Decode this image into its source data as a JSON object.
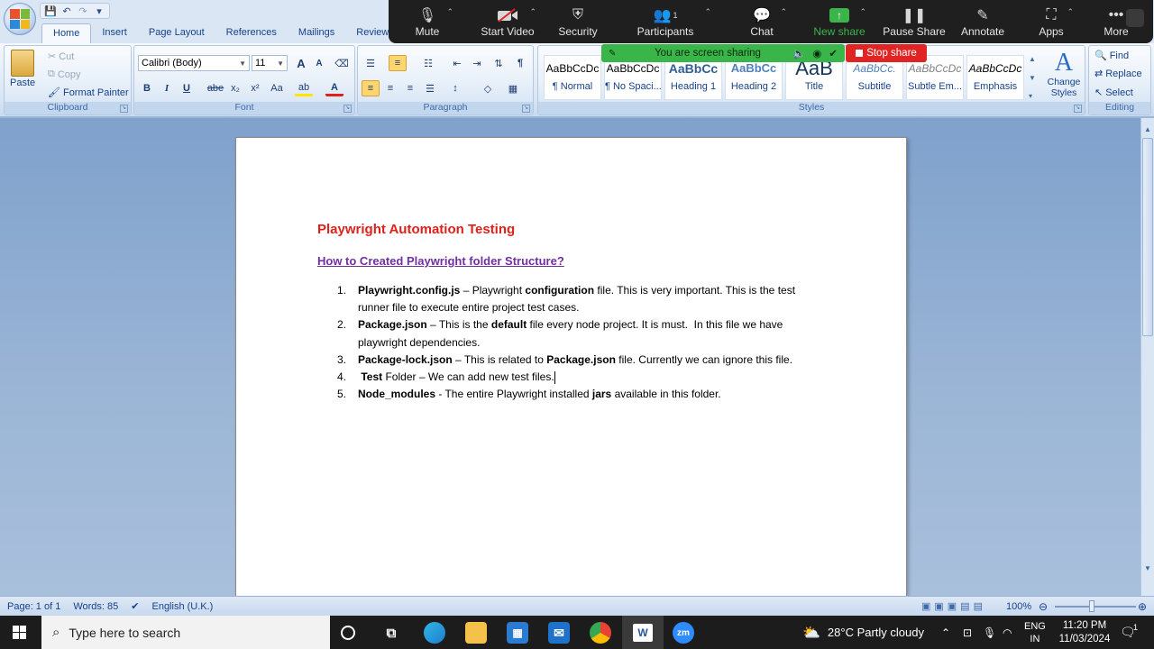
{
  "quick_access": {
    "save_icon": "save-icon",
    "undo_icon": "undo-icon",
    "redo_icon": "redo-icon",
    "more": "▾"
  },
  "tabs": [
    "Home",
    "Insert",
    "Page Layout",
    "References",
    "Mailings",
    "Review"
  ],
  "ribbon": {
    "clipboard": {
      "label": "Clipboard",
      "paste": "Paste",
      "cut": "Cut",
      "copy": "Copy",
      "format_painter": "Format Painter"
    },
    "font": {
      "label": "Font",
      "family": "Calibri (Body)",
      "size": "11",
      "grow": "A",
      "shrink": "A",
      "bold": "B",
      "italic": "I",
      "underline": "U",
      "strike": "abe",
      "sub": "x₂",
      "sup": "x²",
      "case": "Aa",
      "color": "A"
    },
    "paragraph": {
      "label": "Paragraph",
      "show_marks": "¶"
    },
    "styles": {
      "label": "Styles",
      "items": [
        {
          "preview": "AaBbCcDc",
          "name": "¶ Normal"
        },
        {
          "preview": "AaBbCcDc",
          "name": "¶ No Spaci..."
        },
        {
          "preview": "AaBbCc",
          "name": "Heading 1"
        },
        {
          "preview": "AaBbCc",
          "name": "Heading 2"
        },
        {
          "preview": "AaB",
          "name": "Title"
        },
        {
          "preview": "AaBbCc.",
          "name": "Subtitle"
        },
        {
          "preview": "AaBbCcDc",
          "name": "Subtle Em..."
        },
        {
          "preview": "AaBbCcDc",
          "name": "Emphasis"
        }
      ],
      "change_styles": "Change Styles"
    },
    "editing": {
      "label": "Editing",
      "find": "Find",
      "replace": "Replace",
      "select": "Select"
    }
  },
  "zoom_toolbar": {
    "items": [
      {
        "label": "Mute",
        "icon": "microphone-icon"
      },
      {
        "label": "Start Video",
        "icon": "video-off-icon"
      },
      {
        "label": "Security",
        "icon": "shield-icon"
      },
      {
        "label": "Participants",
        "icon": "participants-icon",
        "count": "1"
      },
      {
        "label": "Chat",
        "icon": "chat-icon"
      },
      {
        "label": "New share",
        "icon": "share-icon"
      },
      {
        "label": "Pause Share",
        "icon": "pause-icon"
      },
      {
        "label": "Annotate",
        "icon": "pen-icon"
      },
      {
        "label": "Apps",
        "icon": "apps-icon"
      },
      {
        "label": "More",
        "icon": "more-icon"
      }
    ],
    "sharing_text": "You are screen sharing",
    "stop_share": "Stop share"
  },
  "document": {
    "title": "Playwright Automation Testing",
    "subtitle": "How to Created Playwright folder Structure?",
    "items": [
      {
        "num": "1.",
        "parts": [
          {
            "t": "Playwright.config.js",
            "b": true
          },
          {
            "t": " – Playwright ",
            "b": false
          },
          {
            "t": "configuration",
            "b": true
          },
          {
            "t": " file. This is very important. This is the test runner file to execute entire project test cases.",
            "b": false
          }
        ]
      },
      {
        "num": "2.",
        "parts": [
          {
            "t": "Package.json",
            "b": true
          },
          {
            "t": " – This is the ",
            "b": false
          },
          {
            "t": "default",
            "b": true
          },
          {
            "t": " file every node project. It is must.  In this file we have playwright dependencies.",
            "b": false
          }
        ]
      },
      {
        "num": "3.",
        "parts": [
          {
            "t": "Package-lock.json",
            "b": true
          },
          {
            "t": " – This is related to ",
            "b": false
          },
          {
            "t": "Package.json",
            "b": true
          },
          {
            "t": " file. Currently we can ignore this file.",
            "b": false
          }
        ]
      },
      {
        "num": "4.",
        "parts": [
          {
            "t": " Test",
            "b": true
          },
          {
            "t": " Folder – We can add new test files.",
            "b": false
          }
        ]
      },
      {
        "num": "5.",
        "parts": [
          {
            "t": "Node_modules",
            "b": true
          },
          {
            "t": " - The entire Playwright installed ",
            "b": false
          },
          {
            "t": "jars",
            "b": true
          },
          {
            "t": " available in this folder.",
            "b": false
          }
        ]
      }
    ]
  },
  "status": {
    "page": "Page: 1 of 1",
    "words": "Words: 85",
    "language": "English (U.K.)",
    "zoom": "100%"
  },
  "taskbar": {
    "search_placeholder": "Type here to search",
    "weather": "28°C  Partly cloudy",
    "lang1": "ENG",
    "lang2": "IN",
    "time": "11:20 PM",
    "date": "11/03/2024",
    "notification_count": "1"
  },
  "colors": {
    "title": "#e0201b",
    "subtitle": "#7030a0",
    "zoom_bar": "#1f1f1f",
    "share_green": "#3ab54a",
    "stop_red": "#e02424"
  }
}
